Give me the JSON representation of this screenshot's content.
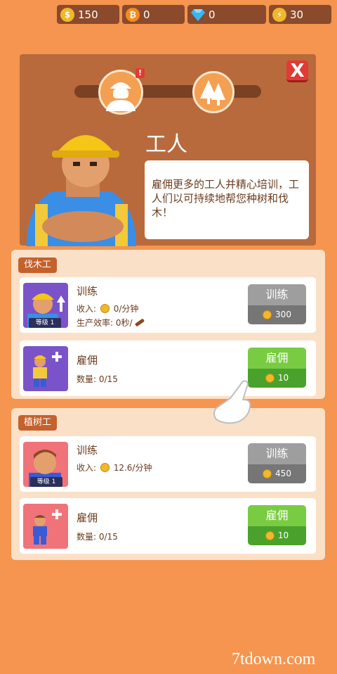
{
  "currency": [
    {
      "name": "coin",
      "value": "150",
      "color": "#f0b82a"
    },
    {
      "name": "bitcoin",
      "value": "0",
      "color": "#f28c1d"
    },
    {
      "name": "diamond",
      "value": "0",
      "color": "#37b6f0"
    },
    {
      "name": "speed",
      "value": "30",
      "color": "#f0b82a"
    }
  ],
  "header": {
    "title": "工人",
    "description": "雇佣更多的工人并精心培训，工人们以可持续地帮您种树和伐木！",
    "alert": "!",
    "close_label": "X"
  },
  "sections": [
    {
      "label": "伐木工",
      "train": {
        "title": "训练",
        "income_label": "收入:",
        "income_value": "0/分钟",
        "efficiency_label": "生产效率:",
        "efficiency_value": "0秒/",
        "level": "等级 1",
        "button_label": "训练",
        "cost": "300"
      },
      "hire": {
        "title": "雇佣",
        "count_label": "数量:",
        "count_value": "0/15",
        "button_label": "雇佣",
        "cost": "10"
      }
    },
    {
      "label": "植树工",
      "train": {
        "title": "训练",
        "income_label": "收入:",
        "income_value": "12.6/分钟",
        "level": "等级 1",
        "button_label": "训练",
        "cost": "450"
      },
      "hire": {
        "title": "雇佣",
        "count_label": "数量:",
        "count_value": "0/15",
        "button_label": "雇佣",
        "cost": "10"
      }
    }
  ],
  "watermark": "7tdown.com"
}
